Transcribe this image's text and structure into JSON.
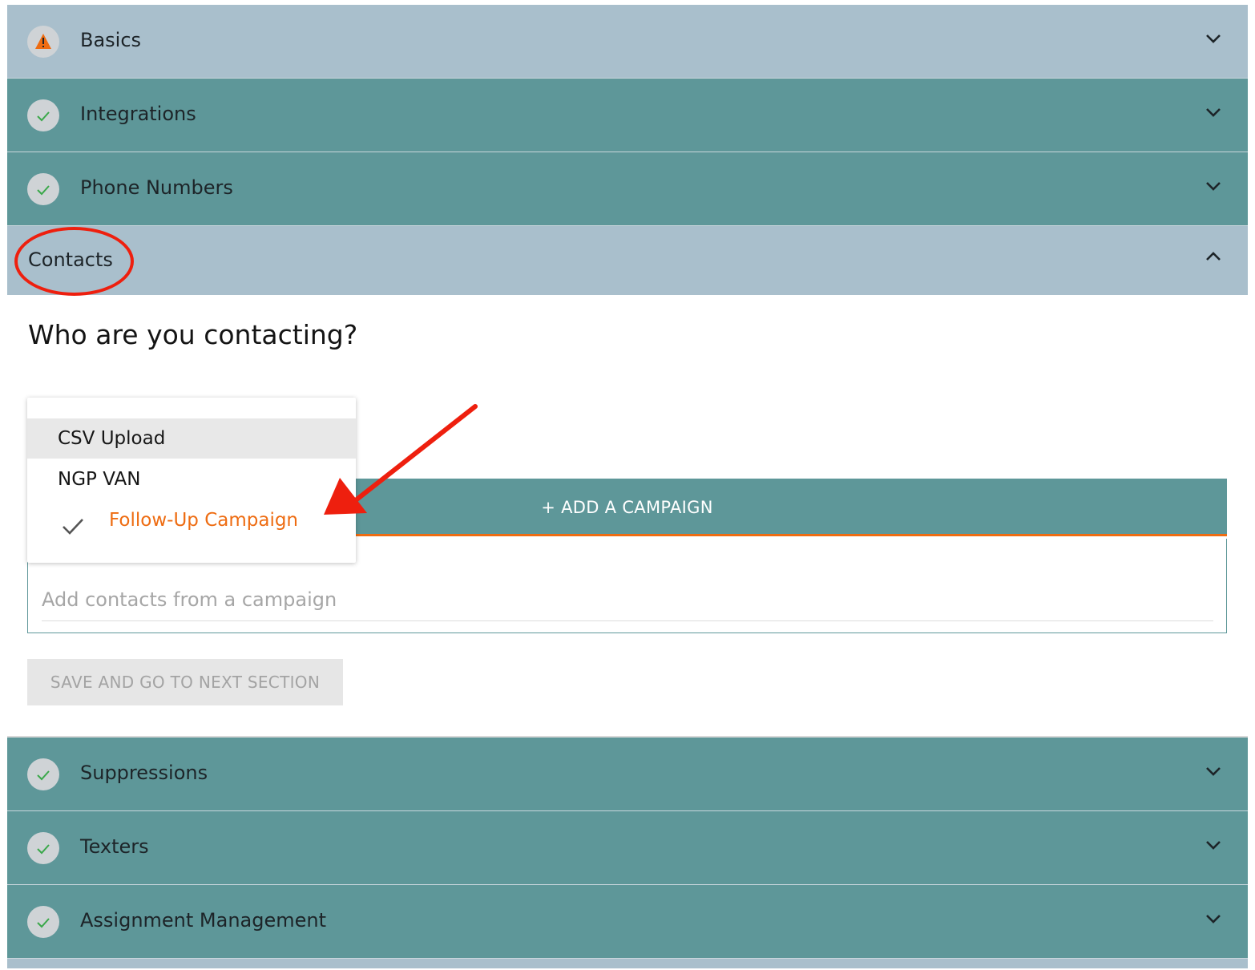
{
  "sections": [
    {
      "label": "Basics",
      "status_icon": "warning-icon",
      "status_color": "#ee6c12",
      "chevron_icon": "chevron-down-icon"
    },
    {
      "label": "Integrations",
      "status_icon": "check-icon",
      "chevron_icon": "chevron-down-icon"
    },
    {
      "label": "Phone Numbers",
      "status_icon": "check-icon",
      "chevron_icon": "chevron-down-icon"
    },
    {
      "label": "Contacts",
      "chevron_icon": "chevron-up-icon",
      "expanded": true
    },
    {
      "label": "Suppressions",
      "status_icon": "check-icon",
      "chevron_icon": "chevron-down-icon"
    },
    {
      "label": "Texters",
      "status_icon": "check-icon",
      "chevron_icon": "chevron-down-icon"
    },
    {
      "label": "Assignment Management",
      "status_icon": "check-icon",
      "chevron_icon": "chevron-down-icon"
    }
  ],
  "contacts": {
    "question": "Who are you contacting?",
    "source_menu": {
      "options": [
        "CSV Upload",
        "NGP VAN",
        "Follow-Up Campaign"
      ],
      "selected": "Follow-Up Campaign"
    },
    "add_campaign_label": "+ ADD A CAMPAIGN",
    "campaign_input_placeholder": "Add contacts from a campaign",
    "save_label": "SAVE AND GO TO NEXT SECTION"
  },
  "colors": {
    "panel_light": "#a9bfcc",
    "panel_teal": "#5e9799",
    "accent_orange": "#ee6c12",
    "check_green": "#3aa84a",
    "annotation_red": "#ee1f0e"
  }
}
